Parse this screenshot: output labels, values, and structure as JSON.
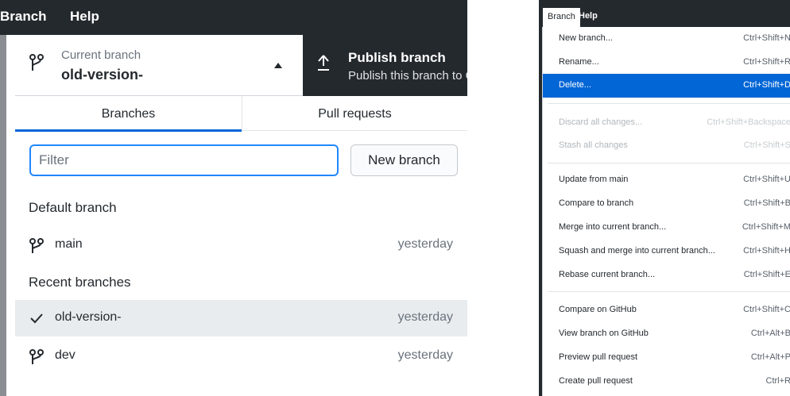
{
  "left_panel": {
    "menubar": {
      "branch": "Branch",
      "help": "Help"
    },
    "current_branch": {
      "label": "Current branch",
      "value": "old-version-"
    },
    "publish": {
      "title": "Publish branch",
      "description": "Publish this branch to GitHub"
    },
    "tabs": {
      "branches": "Branches",
      "pull_requests": "Pull requests"
    },
    "filter": {
      "placeholder": "Filter"
    },
    "new_branch_button": "New branch",
    "default_section": "Default branch",
    "recent_section": "Recent branches",
    "branches": [
      {
        "name": "main",
        "time": "yesterday"
      },
      {
        "name": "old-version-",
        "time": "yesterday",
        "selected": true
      },
      {
        "name": "dev",
        "time": "yesterday"
      }
    ]
  },
  "right_panel": {
    "menubar": {
      "branch": "Branch",
      "help": "Help"
    },
    "menu_items": [
      {
        "label": "New branch...",
        "shortcut": "Ctrl+Shift+N"
      },
      {
        "label": "Rename...",
        "shortcut": "Ctrl+Shift+R"
      },
      {
        "label": "Delete...",
        "shortcut": "Ctrl+Shift+D",
        "highlighted": true
      },
      {
        "label": "Discard all changes...",
        "shortcut": "Ctrl+Shift+Backspace",
        "disabled": true
      },
      {
        "label": "Stash all changes",
        "shortcut": "Ctrl+Shift+S",
        "disabled": true
      },
      {
        "label": "Update from main",
        "shortcut": "Ctrl+Shift+U"
      },
      {
        "label": "Compare to branch",
        "shortcut": "Ctrl+Shift+B"
      },
      {
        "label": "Merge into current branch...",
        "shortcut": "Ctrl+Shift+M"
      },
      {
        "label": "Squash and merge into current branch...",
        "shortcut": "Ctrl+Shift+H"
      },
      {
        "label": "Rebase current branch...",
        "shortcut": "Ctrl+Shift+E"
      },
      {
        "label": "Compare on GitHub",
        "shortcut": "Ctrl+Shift+C"
      },
      {
        "label": "View branch on GitHub",
        "shortcut": "Ctrl+Alt+B"
      },
      {
        "label": "Preview pull request",
        "shortcut": "Ctrl+Alt+P"
      },
      {
        "label": "Create pull request",
        "shortcut": "Ctrl+R"
      }
    ]
  },
  "colors": {
    "dark": "#24292e",
    "accent": "#0366d6",
    "focus": "#2188ff",
    "selected_row": "#e9ecef"
  },
  "icons": {
    "branch": "git-branch-icon",
    "caret": "caret-up-icon",
    "publish": "upload-arrow-icon",
    "check": "checkmark-icon"
  }
}
